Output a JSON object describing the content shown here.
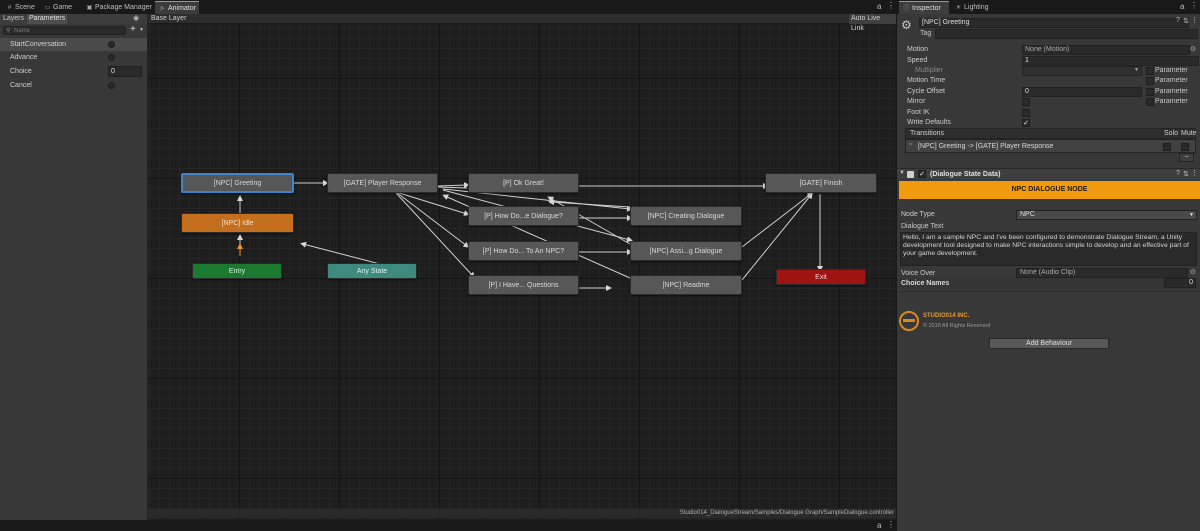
{
  "tabs_left": [
    {
      "label": "Scene",
      "icon": "#"
    },
    {
      "label": "Game",
      "icon": "▭"
    },
    {
      "label": "Package Manager",
      "icon": "▣"
    },
    {
      "label": "Animator",
      "icon": "⊱"
    }
  ],
  "tabs_right": [
    {
      "label": "Inspector",
      "icon": "ⓘ"
    },
    {
      "label": "Lighting",
      "icon": "☀"
    }
  ],
  "params": {
    "tab_layers": "Layers",
    "tab_parameters": "Parameters",
    "search_placeholder": "Name",
    "add_button": "+",
    "items": [
      {
        "name": "StartConversation",
        "type": "trigger",
        "value": ""
      },
      {
        "name": "Advance",
        "type": "trigger",
        "value": ""
      },
      {
        "name": "Choice",
        "type": "int",
        "value": "0"
      },
      {
        "name": "Cancel",
        "type": "trigger",
        "value": ""
      }
    ]
  },
  "graph": {
    "layer": "Base Layer",
    "auto_live_link": "Auto Live Link",
    "path": "Studio014_DialogueStream/Samples/Dialogue Graph/SampleDialogue.controller",
    "nodes": {
      "greeting": "[NPC] Greeting",
      "idle": "[NPC] Idle",
      "entry": "Entry",
      "any_state": "Any State",
      "gate_response": "[GATE] Player Response",
      "ok_great": "[P] Ok Great!",
      "how_dialogue": "[P] How Do...e Dialogue?",
      "how_npc": "[P] How Do... To An NPC?",
      "have_questions": "[P] I Have... Questions",
      "creating_dialogue": "[NPC] Creating Dialogue",
      "assigning_dialogue": "[NPC] Assi...g Dialogue",
      "readme": "[NPC] Readme",
      "gate_finish": "[GATE] Finish",
      "exit": "Exit"
    }
  },
  "inspector": {
    "object_name": "[NPC] Greeting",
    "tag_label": "Tag",
    "motion_label": "Motion",
    "motion_value": "None (Motion)",
    "speed_label": "Speed",
    "speed_value": "1",
    "multiplier_label": "Multiplier",
    "parameter_label": "Parameter",
    "motion_time_label": "Motion Time",
    "cycle_offset_label": "Cycle Offset",
    "cycle_offset_value": "0",
    "mirror_label": "Mirror",
    "foot_ik_label": "Foot IK",
    "write_defaults_label": "Write Defaults",
    "transitions_label": "Transitions",
    "solo_label": "Solo",
    "mute_label": "Mute",
    "transition_item": "[NPC] Greeting -> [GATE] Player Response",
    "component_title": "(Dialogue State Data)",
    "banner": "NPC DIALOGUE NODE",
    "node_type_label": "Node Type",
    "node_type_value": "NPC",
    "dialogue_text_label": "Dialogue Text",
    "dialogue_text": "Hello, I am a sample NPC and I've been configured to demonstrate Dialogue Stream, a Unity development tool designed to make NPC interactions simple to develop and an effective part of your game development.",
    "voice_over_label": "Voice Over",
    "voice_over_value": "None (Audio Clip)",
    "choice_names_label": "Choice Names",
    "choice_names_count": "0",
    "studio_name": "STUDIO014 INC.",
    "copyright": "© 2018 All Rights Reserved",
    "add_behaviour": "Add Behaviour"
  },
  "colors": {
    "accent": "#f29a0e",
    "selection": "#3f84c8",
    "entry": "#1b7a2f",
    "exit": "#9f1313",
    "idle": "#c46f1e",
    "any_state": "#3f8a7f"
  }
}
